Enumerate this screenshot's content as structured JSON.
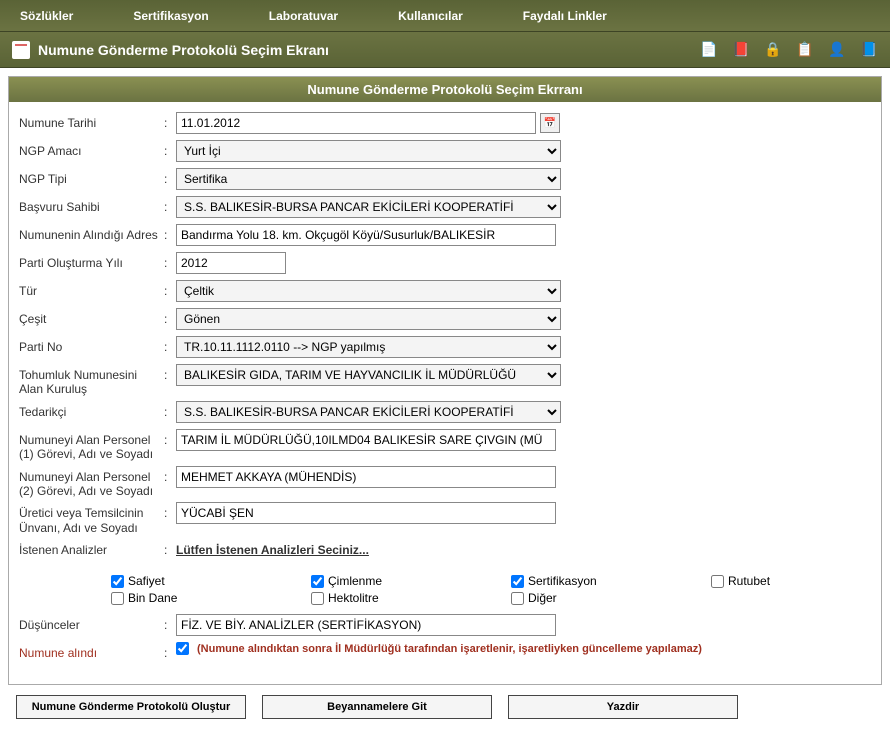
{
  "nav": {
    "items": [
      "Sözlükler",
      "Sertifikasyon",
      "Laboratuvar",
      "Kullanıcılar",
      "Faydalı Linkler"
    ]
  },
  "header": {
    "title": "Numune Gönderme Protokolü Seçim Ekranı"
  },
  "panel": {
    "title": "Numune Gönderme Protokolü Seçim Ekrranı"
  },
  "form": {
    "numune_tarihi_label": "Numune Tarihi",
    "numune_tarihi": "11.01.2012",
    "ngp_amaci_label": "NGP Amacı",
    "ngp_amaci": "Yurt İçi",
    "ngp_tipi_label": "NGP Tipi",
    "ngp_tipi": "Sertifika",
    "basvuru_sahibi_label": "Başvuru Sahibi",
    "basvuru_sahibi": "S.S. BALIKESİR-BURSA PANCAR EKİCİLERİ KOOPERATİFİ",
    "adres_label": "Numunenin Alındığı Adres",
    "adres": "Bandırma Yolu 18. km. Okçugöl Köyü/Susurluk/BALIKESİR",
    "parti_yili_label": "Parti Oluşturma Yılı",
    "parti_yili": "2012",
    "tur_label": "Tür",
    "tur": "Çeltik",
    "cesit_label": "Çeşit",
    "cesit": "Gönen",
    "parti_no_label": "Parti No",
    "parti_no": "TR.10.11.1112.0110 --> NGP yapılmış",
    "tohumluk_label": "Tohumluk Numunesini Alan Kuruluş",
    "tohumluk": "BALIKESİR GIDA, TARIM VE HAYVANCILIK İL MÜDÜRLÜĞÜ",
    "tedarikci_label": "Tedarikçi",
    "tedarikci": "S.S. BALIKESİR-BURSA PANCAR EKİCİLERİ KOOPERATİFİ",
    "personel1_label": "Numuneyi Alan Personel (1) Görevi, Adı ve Soyadı",
    "personel1": "TARIM İL MÜDÜRLÜĞÜ,10ILMD04 BALIKESİR SARE ÇIVGIN (MÜ",
    "personel2_label": "Numuneyi Alan Personel (2) Görevi, Adı ve Soyadı",
    "personel2": "MEHMET AKKAYA (MÜHENDİS)",
    "uretici_label": "Üretici veya Temsilcinin Ünvanı, Adı ve Soyadı",
    "uretici": "YÜCABİ ŞEN",
    "istenen_label": "İstenen Analizler",
    "istenen_link": "Lütfen İstenen Analizleri Seciniz...",
    "dusunceler_label": "Düşünceler",
    "dusunceler": "FİZ. VE BİY. ANALİZLER (SERTİFİKASYON)",
    "numune_alindi_label": "Numune alındı",
    "numune_alindi_note": "(Numune alındıktan sonra İl Müdürlüğü tarafından işaretlenir, işaretliyken güncelleme yapılamaz)"
  },
  "checks": {
    "safiyet": "Safiyet",
    "bin_dane": "Bin Dane",
    "cimlenme": "Çimlenme",
    "hektolitre": "Hektolitre",
    "sertifikasyon": "Sertifikasyon",
    "diger": "Diğer",
    "rutubet": "Rutubet"
  },
  "buttons": {
    "olustur": "Numune Gönderme Protokolü Oluştur",
    "beyannamelere": "Beyannamelere Git",
    "yazdir": "Yazdir"
  }
}
